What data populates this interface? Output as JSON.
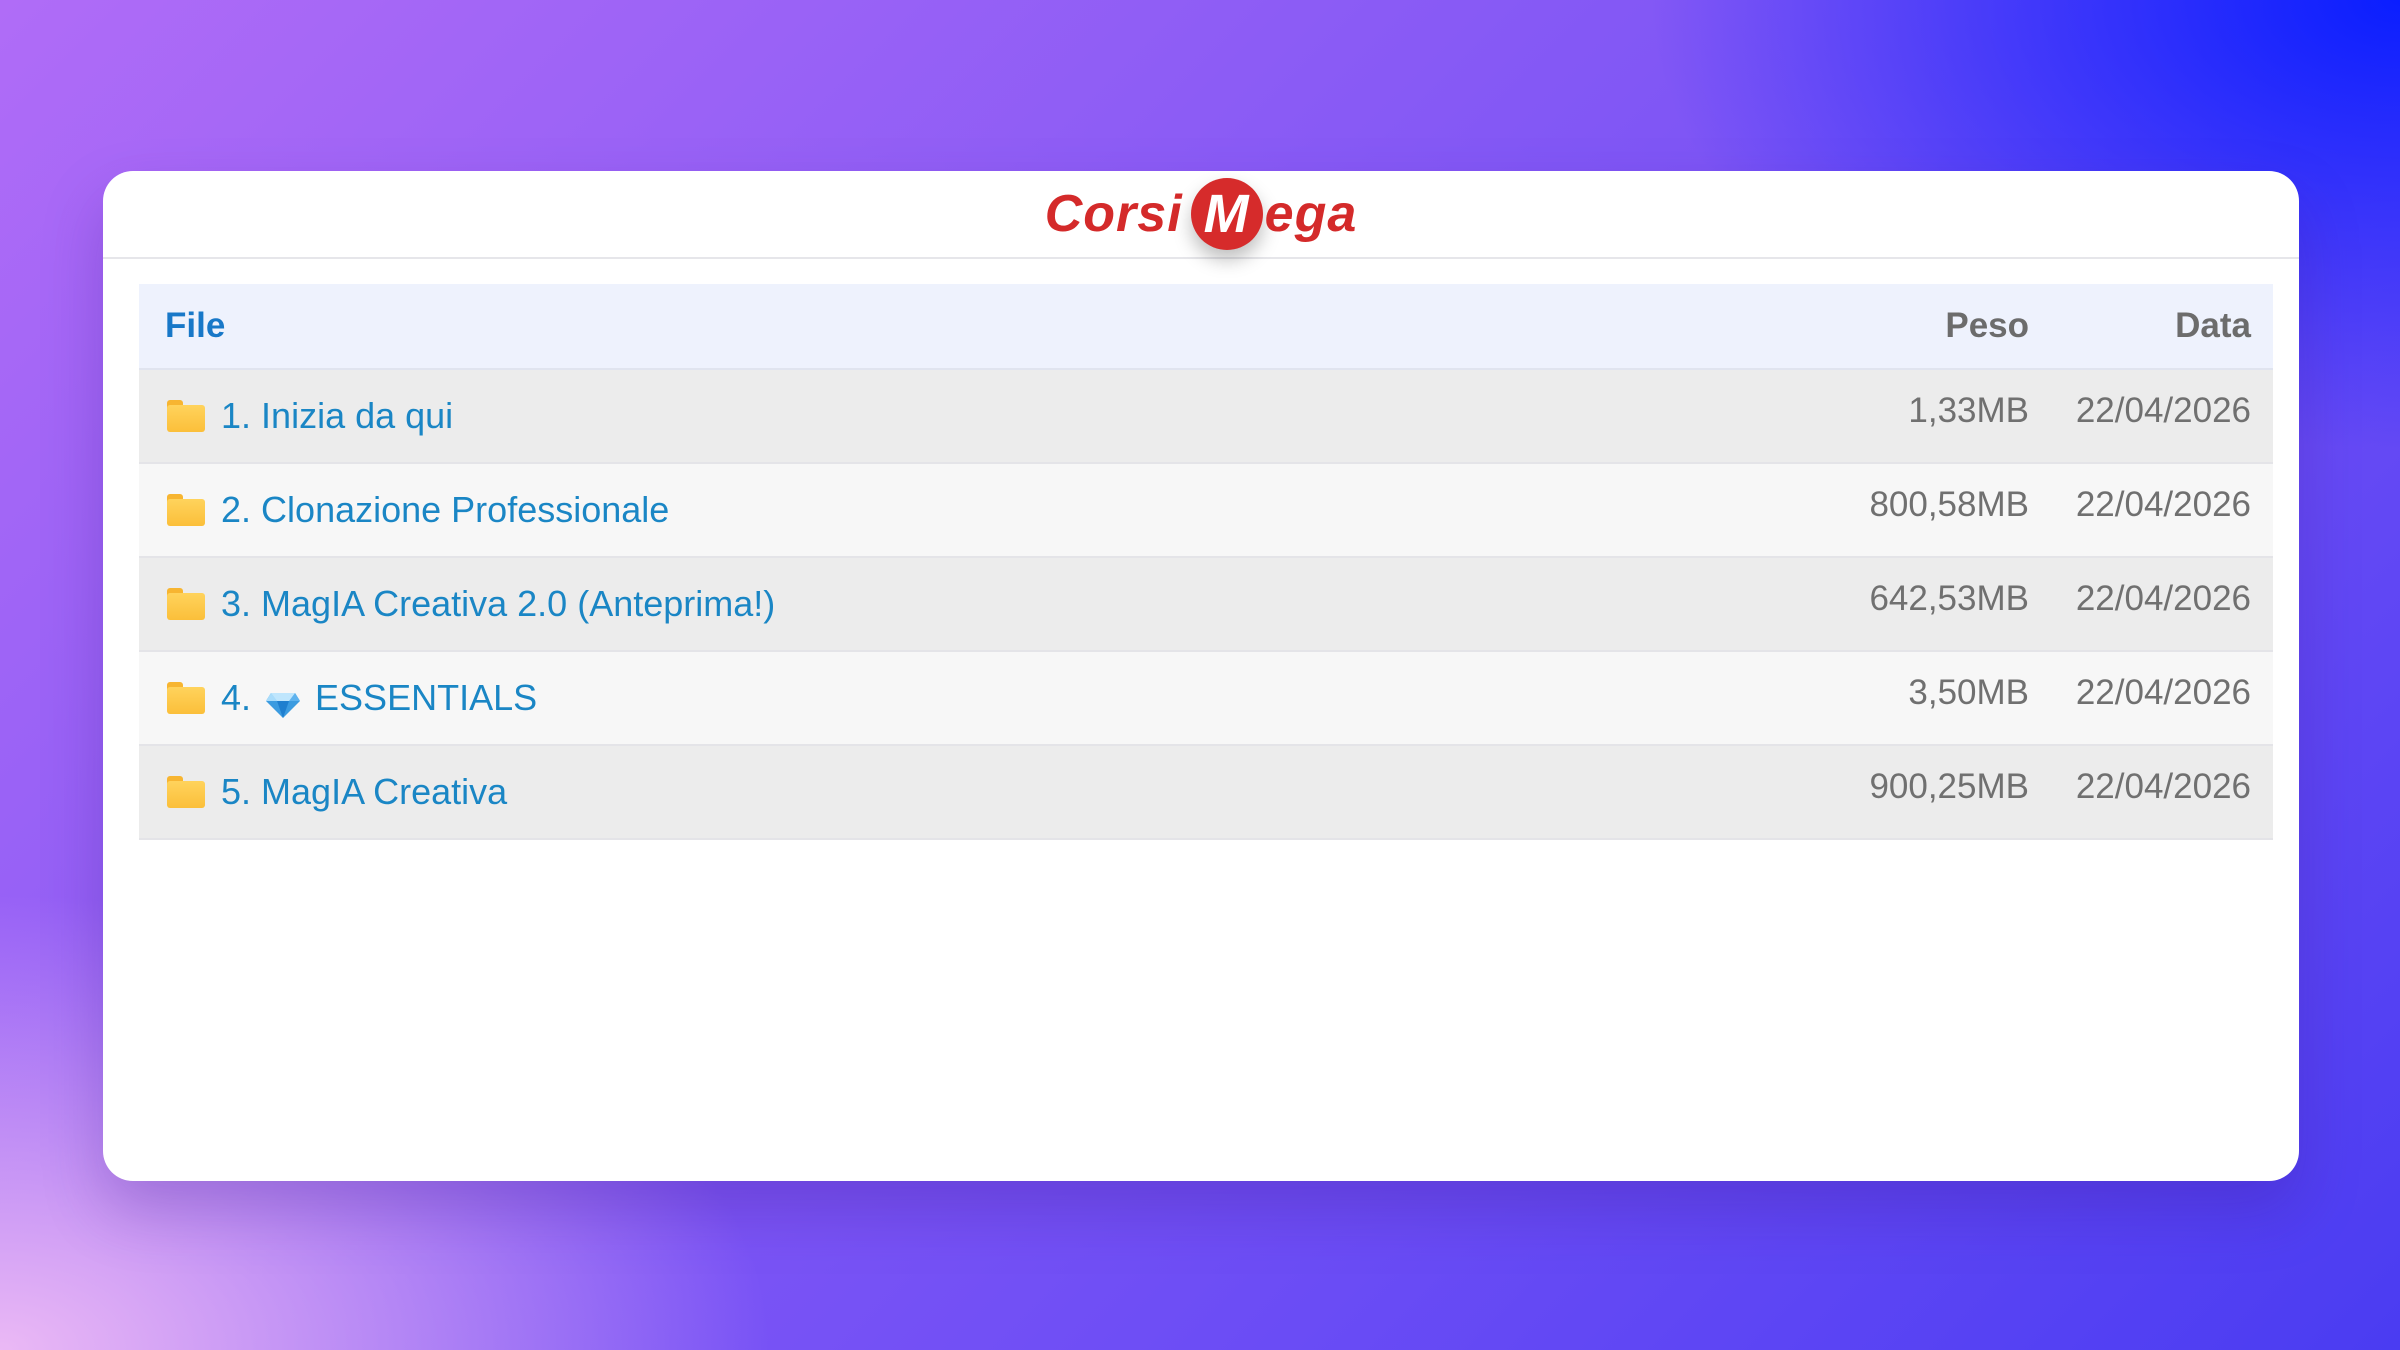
{
  "header": {
    "logo_word_1": "Corsi",
    "logo_badge_letter": "M",
    "logo_word_2": "ega"
  },
  "table": {
    "columns": {
      "file": "File",
      "peso": "Peso",
      "data": "Data"
    },
    "rows": [
      {
        "prefix": "1.",
        "name": "Inizia da qui",
        "size": "1,33MB",
        "date": "22/04/2026",
        "icon": "folder-icon"
      },
      {
        "prefix": "2.",
        "name": "Clonazione Professionale",
        "size": "800,58MB",
        "date": "22/04/2026",
        "icon": "folder-icon"
      },
      {
        "prefix": "3.",
        "name": "MagIA Creativa 2.0 (Anteprima!)",
        "size": "642,53MB",
        "date": "22/04/2026",
        "icon": "folder-icon"
      },
      {
        "prefix": "4.",
        "name": "ESSENTIALS",
        "size": "3,50MB",
        "date": "22/04/2026",
        "icon": "folder-icon",
        "extra_icon": "gem-icon"
      },
      {
        "prefix": "5.",
        "name": "MagIA Creativa",
        "size": "900,25MB",
        "date": "22/04/2026",
        "icon": "folder-icon"
      }
    ]
  },
  "colors": {
    "link": "#1a86c5",
    "header_link": "#1878c8",
    "brand_red": "#d42a2a",
    "folder": "#fbbf3a"
  }
}
